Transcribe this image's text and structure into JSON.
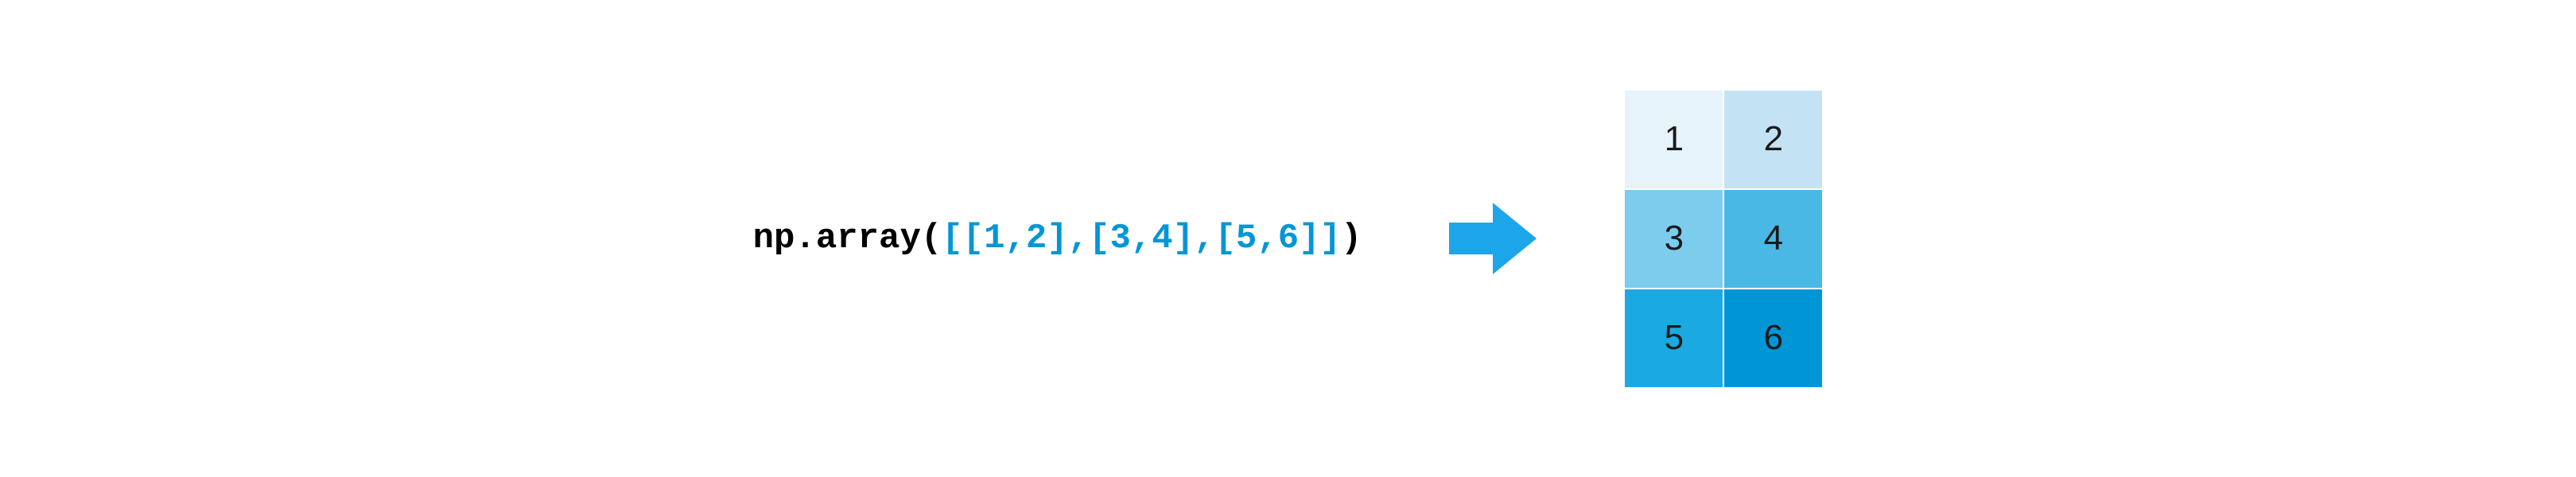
{
  "code": {
    "prefix": "np.array(",
    "array_literal": "[[1,2],[3,4],[5,6]]",
    "suffix": ")"
  },
  "matrix": {
    "rows": 3,
    "cols": 2,
    "cells": [
      "1",
      "2",
      "3",
      "4",
      "5",
      "6"
    ]
  },
  "colors": {
    "arrow": "#1da5ea",
    "code_black": "#000000",
    "code_blue": "#0096d6"
  }
}
